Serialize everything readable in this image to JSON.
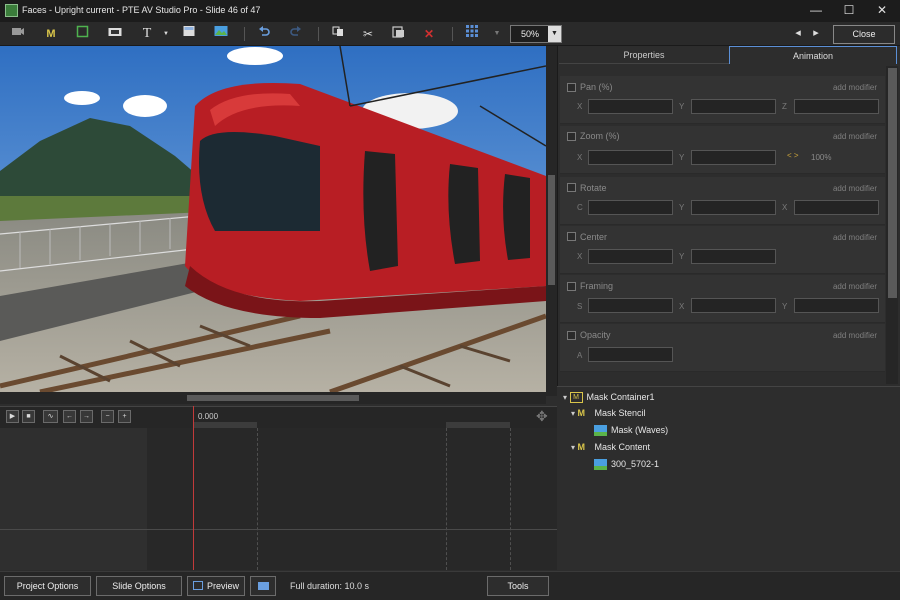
{
  "window": {
    "title": "Faces - Upright current - PTE AV Studio Pro - Slide 46 of 47",
    "minimize": "—",
    "maximize": "☐",
    "close": "✕"
  },
  "toolbar": {
    "zoom": "50%",
    "zoom_arrow": "▼",
    "close_label": "Close",
    "text_tool": "T",
    "mask_tool": "M",
    "nav_prev": "◂",
    "nav_next": "▸"
  },
  "tabs": {
    "properties": "Properties",
    "animation": "Animation"
  },
  "animation": {
    "add_modifier": "add modifier",
    "sections": [
      {
        "label": "Pan (%)",
        "fields": [
          "X",
          "Y",
          "Z"
        ]
      },
      {
        "label": "Zoom (%)",
        "fields": [
          "X",
          "Y"
        ],
        "extra": "100%"
      },
      {
        "label": "Rotate",
        "fields": [
          "C",
          "Y",
          "X"
        ]
      },
      {
        "label": "Center",
        "fields": [
          "X",
          "Y"
        ]
      },
      {
        "label": "Framing",
        "fields": [
          "S",
          "X",
          "Y"
        ]
      },
      {
        "label": "Opacity",
        "fields": [
          "A"
        ]
      }
    ]
  },
  "object_tree": [
    {
      "label": "Mask Container1",
      "level": 0,
      "icon": "mask-container-icon"
    },
    {
      "label": "Mask Stencil",
      "level": 1,
      "icon": "mask-stencil-icon"
    },
    {
      "label": "Mask (Waves)",
      "level": 2,
      "icon": "image-icon"
    },
    {
      "label": "Mask Content",
      "level": 1,
      "icon": "mask-content-icon"
    },
    {
      "label": "300_5702-1",
      "level": 2,
      "icon": "image-icon"
    }
  ],
  "timeline": {
    "time": "0.000"
  },
  "status": {
    "project_options": "Project Options",
    "slide_options": "Slide Options",
    "preview": "Preview",
    "duration": "Full duration: 10.0 s",
    "tools": "Tools"
  },
  "colors": {
    "accent": "#5b8fd6",
    "tram_red": "#b81e24",
    "playhead": "#c23a3a"
  }
}
